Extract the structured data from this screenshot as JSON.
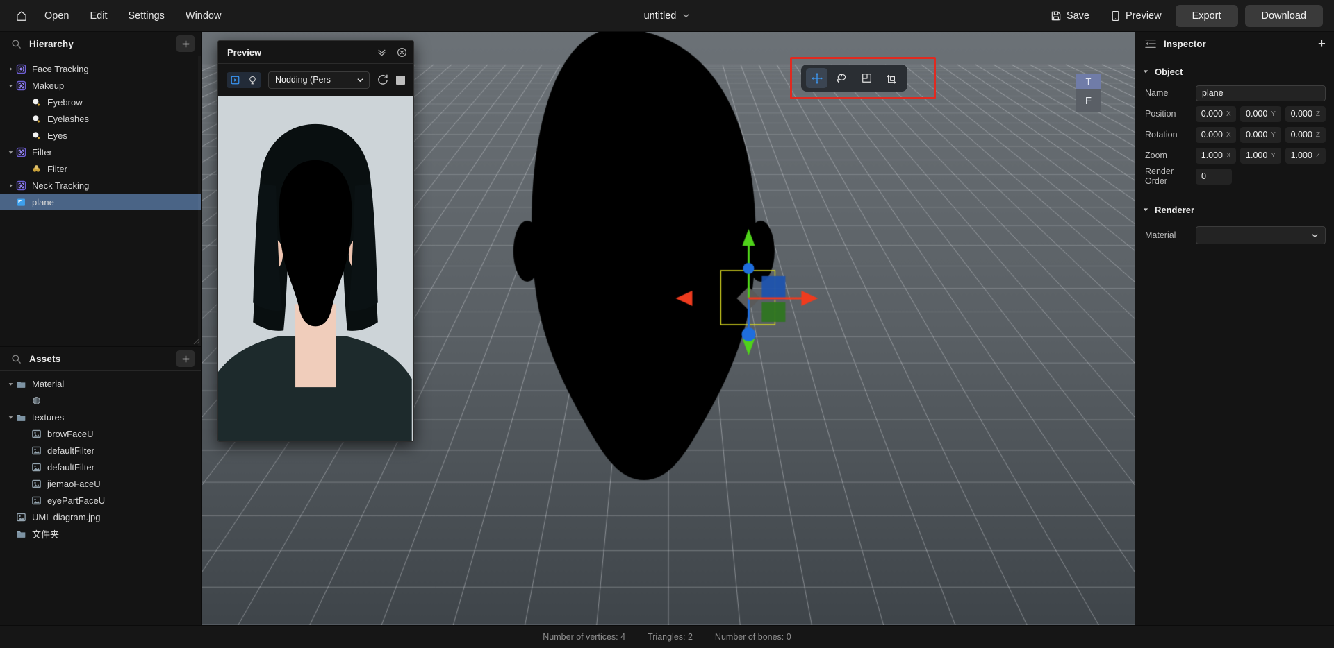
{
  "topbar": {
    "home_icon": "home-icon",
    "menus": [
      "Open",
      "Edit",
      "Settings",
      "Window"
    ],
    "document_title": "untitled",
    "actions": [
      {
        "label": "Save",
        "icon": "save-disk-icon"
      },
      {
        "label": "Preview",
        "icon": "phone-preview-icon"
      }
    ],
    "export_label": "Export",
    "download_label": "Download"
  },
  "hierarchy": {
    "title": "Hierarchy",
    "search_icon": "search-icon",
    "add_icon": "plus-icon",
    "items": [
      {
        "label": "Face Tracking",
        "icon": "tracking-node-icon",
        "depth": 0,
        "expanded": false,
        "has_children": true,
        "selected": false
      },
      {
        "label": "Makeup",
        "icon": "tracking-node-icon",
        "depth": 0,
        "expanded": true,
        "has_children": true,
        "selected": false
      },
      {
        "label": "Eyebrow",
        "icon": "makeup-sparkle-icon",
        "depth": 1,
        "expanded": false,
        "has_children": false,
        "selected": false
      },
      {
        "label": "Eyelashes",
        "icon": "makeup-sparkle-icon",
        "depth": 1,
        "expanded": false,
        "has_children": false,
        "selected": false
      },
      {
        "label": "Eyes",
        "icon": "makeup-sparkle-icon",
        "depth": 1,
        "expanded": false,
        "has_children": false,
        "selected": false
      },
      {
        "label": "Filter",
        "icon": "tracking-node-icon",
        "depth": 0,
        "expanded": true,
        "has_children": true,
        "selected": false
      },
      {
        "label": "Filter",
        "icon": "filter-bubbles-icon",
        "depth": 1,
        "expanded": false,
        "has_children": false,
        "selected": false
      },
      {
        "label": "Neck Tracking",
        "icon": "tracking-node-icon",
        "depth": 0,
        "expanded": false,
        "has_children": true,
        "selected": false
      },
      {
        "label": "plane",
        "icon": "mesh-plane-icon",
        "depth": 0,
        "expanded": false,
        "has_children": false,
        "selected": true
      }
    ]
  },
  "assets": {
    "title": "Assets",
    "search_icon": "search-icon",
    "add_icon": "plus-icon",
    "items": [
      {
        "label": "Material",
        "icon": "folder-icon",
        "depth": 0,
        "expanded": true,
        "has_children": true
      },
      {
        "label": "",
        "icon": "material-ball-icon",
        "depth": 1,
        "expanded": false,
        "has_children": false
      },
      {
        "label": "textures",
        "icon": "folder-icon",
        "depth": 0,
        "expanded": true,
        "has_children": true
      },
      {
        "label": "browFaceU",
        "icon": "image-file-icon",
        "depth": 1,
        "expanded": false,
        "has_children": false
      },
      {
        "label": "defaultFilter",
        "icon": "image-file-icon",
        "depth": 1,
        "expanded": false,
        "has_children": false
      },
      {
        "label": "defaultFilter",
        "icon": "image-file-icon",
        "depth": 1,
        "expanded": false,
        "has_children": false
      },
      {
        "label": "jiemaoFaceU",
        "icon": "image-file-icon",
        "depth": 1,
        "expanded": false,
        "has_children": false
      },
      {
        "label": "eyePartFaceU",
        "icon": "image-file-icon",
        "depth": 1,
        "expanded": false,
        "has_children": false
      },
      {
        "label": "UML diagram.jpg",
        "icon": "image-file-icon",
        "depth": 0,
        "expanded": false,
        "has_children": false
      },
      {
        "label": "文件夹",
        "icon": "folder-icon",
        "depth": 0,
        "expanded": false,
        "has_children": false
      }
    ]
  },
  "preview_window": {
    "title": "Preview",
    "collapse_icon": "double-chevron-down-icon",
    "close_icon": "close-circle-icon",
    "mode_buttons": [
      {
        "icon": "video-play-icon",
        "active": true
      },
      {
        "icon": "lightbulb-icon",
        "active": false
      }
    ],
    "animation_select": "Nodding (Pers",
    "refresh_icon": "refresh-icon",
    "stop_icon": "stop-square-icon"
  },
  "viewport": {
    "tools": [
      {
        "icon": "move-tool-icon",
        "active": true
      },
      {
        "icon": "rotate-tool-icon",
        "active": false
      },
      {
        "icon": "scale-tool-icon",
        "active": false
      },
      {
        "icon": "transform-tool-icon",
        "active": false
      }
    ],
    "highlight_color": "#e02a20",
    "viewcube": {
      "top_label": "T",
      "front_label": "F",
      "top_color": "#707ca8",
      "front_color": "#5a5f66"
    },
    "gizmo": {
      "x_axis_color": "#ef3b1e",
      "y_axis_color": "#4fd21a",
      "z_axis_color": "#1f6ede",
      "selection_color": "#d8d820"
    }
  },
  "inspector": {
    "title": "Inspector",
    "panel_icon": "inspector-lines-icon",
    "add_icon": "plus-icon",
    "sections": [
      {
        "name": "Object",
        "expanded": true
      },
      {
        "name": "Renderer",
        "expanded": true
      }
    ],
    "object": {
      "name_label": "Name",
      "name_value": "plane",
      "position_label": "Position",
      "position": {
        "x": "0.000",
        "y": "0.000",
        "z": "0.000"
      },
      "rotation_label": "Rotation",
      "rotation": {
        "x": "0.000",
        "y": "0.000",
        "z": "0.000"
      },
      "zoom_label": "Zoom",
      "zoom": {
        "x": "1.000",
        "y": "1.000",
        "z": "1.000"
      },
      "render_order_label": "Render Order",
      "render_order_value": "0",
      "axis_x": "X",
      "axis_y": "Y",
      "axis_z": "Z"
    },
    "renderer": {
      "material_label": "Material",
      "material_value": "",
      "chevron_icon": "chevron-down-icon"
    }
  },
  "statusbar": {
    "vertices": "Number of vertices: 4",
    "triangles": "Triangles: 2",
    "bones": "Number of bones: 0"
  }
}
